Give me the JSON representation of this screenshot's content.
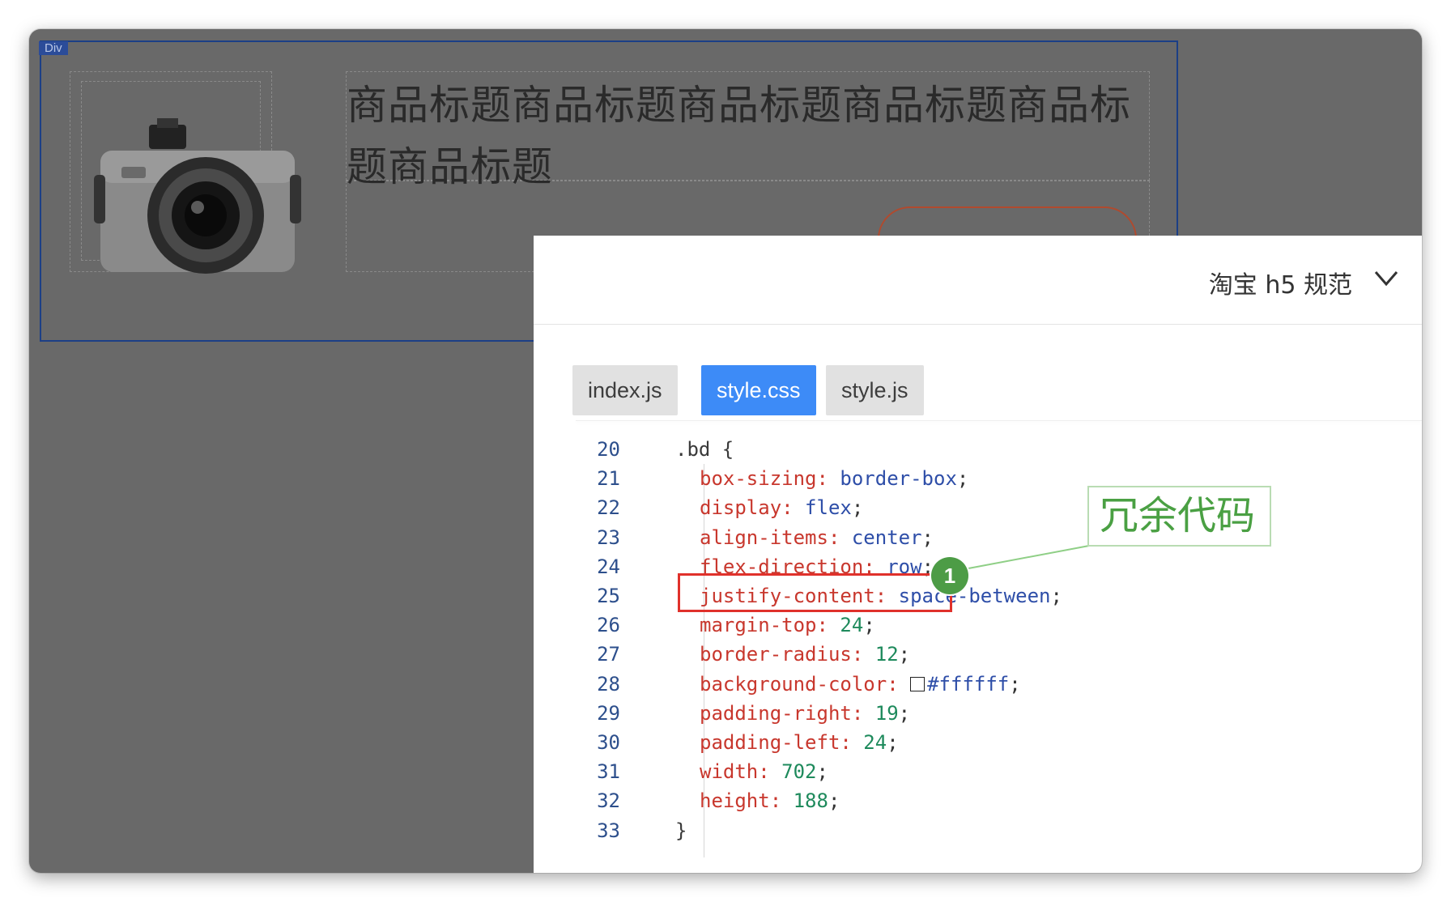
{
  "canvas": {
    "selection_tag": "Div",
    "product_title": "商品标题商品标题商品标题商品标题商品标题商品标题"
  },
  "panel": {
    "spec_selector": "淘宝 h5 规范",
    "tabs": [
      {
        "label": "index.js",
        "active": false
      },
      {
        "label": "style.css",
        "active": true
      },
      {
        "label": "style.js",
        "active": false
      }
    ],
    "code_lines": [
      {
        "n": "20",
        "sel": ".bd {"
      },
      {
        "n": "21",
        "prop": "box-sizing:",
        "val": "border-box",
        "punc": ";"
      },
      {
        "n": "22",
        "prop": "display:",
        "val": "flex",
        "punc": ";"
      },
      {
        "n": "23",
        "prop": "align-items:",
        "val": "center",
        "punc": ";"
      },
      {
        "n": "24",
        "prop": "flex-direction:",
        "val": "row",
        "punc": ";"
      },
      {
        "n": "25",
        "prop": "justify-content:",
        "val": "space-between",
        "punc": ";"
      },
      {
        "n": "26",
        "prop": "margin-top:",
        "num": "24",
        "punc": ";"
      },
      {
        "n": "27",
        "prop": "border-radius:",
        "num": "12",
        "punc": ";"
      },
      {
        "n": "28",
        "prop": "background-color:",
        "val": "#ffffff",
        "punc": ";",
        "swatch": true
      },
      {
        "n": "29",
        "prop": "padding-right:",
        "num": "19",
        "punc": ";"
      },
      {
        "n": "30",
        "prop": "padding-left:",
        "num": "24",
        "punc": ";"
      },
      {
        "n": "31",
        "prop": "width:",
        "num": "702",
        "punc": ";"
      },
      {
        "n": "32",
        "prop": "height:",
        "num": "188",
        "punc": ";"
      },
      {
        "n": "33",
        "sel": "}"
      }
    ]
  },
  "annotation": {
    "badge_number": "1",
    "callout_text": "冗余代码"
  },
  "colors": {
    "overlay": "#696969",
    "active_tab": "#3d8bf7",
    "highlight_box": "#e0312b",
    "annotation_green": "#4d9c46"
  }
}
